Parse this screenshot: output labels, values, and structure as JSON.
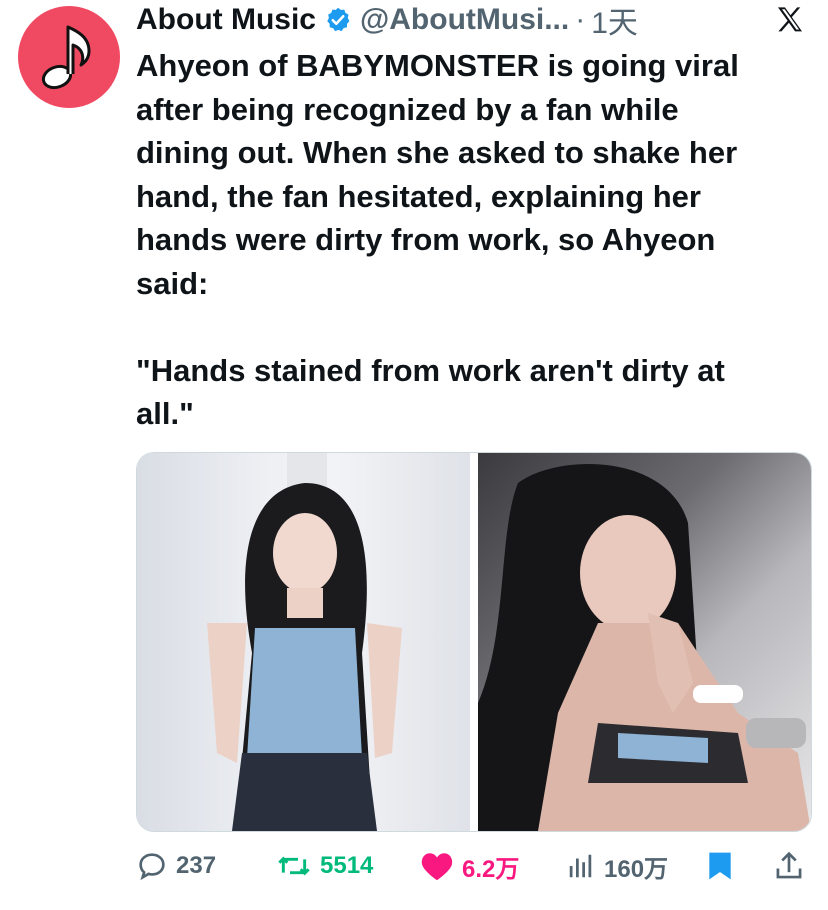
{
  "author": {
    "name": "About Music",
    "handle": "@AboutMusi...",
    "separator": "·",
    "time": "1天"
  },
  "tweet": {
    "text": "Ahyeon of BABYMONSTER is going viral\nafter being recognized by a fan while\ndining out. When she asked to shake her\nhand, the fan hesitated, explaining her\nhands were dirty from work, so Ahyeon\nsaid:\n\n\"Hands stained from work aren't dirty at\nall.\""
  },
  "metrics": {
    "replies": "237",
    "reposts": "5514",
    "likes": "6.2万",
    "views": "160万"
  },
  "colors": {
    "avatar_bg": "#f04a63",
    "verified": "#1d9bf0",
    "repost": "#00ba7c",
    "like": "#f91880",
    "bookmark": "#1d9bf0",
    "secondary": "#536471"
  },
  "icons": [
    "music-note-icon",
    "verified-badge-icon",
    "x-logo-icon",
    "reply-icon",
    "repost-icon",
    "like-icon",
    "views-icon",
    "bookmark-icon",
    "share-icon"
  ]
}
